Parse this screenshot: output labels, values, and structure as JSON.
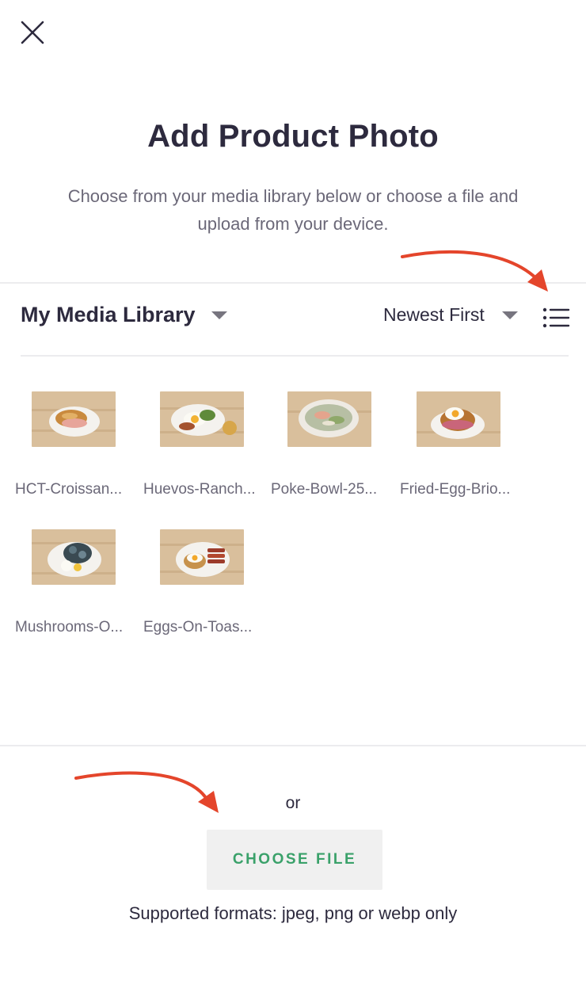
{
  "header": {
    "close_icon": "close-icon",
    "title": "Add Product Photo",
    "subtitle": "Choose from your media library below or choose a file and upload from your device."
  },
  "toolbar": {
    "library_label": "My Media Library",
    "sort_label": "Newest First",
    "list_view_icon": "list-view-icon"
  },
  "media": [
    {
      "name": "HCT-Croissan...",
      "plate": "croissant"
    },
    {
      "name": "Huevos-Ranch...",
      "plate": "huevos"
    },
    {
      "name": "Poke-Bowl-25...",
      "plate": "poke"
    },
    {
      "name": "Fried-Egg-Brio...",
      "plate": "brioche"
    },
    {
      "name": "Mushrooms-O...",
      "plate": "mushrooms"
    },
    {
      "name": "Eggs-On-Toas...",
      "plate": "eggs-toast"
    }
  ],
  "upload": {
    "or_text": "or",
    "choose_label": "CHOOSE FILE",
    "formats_text": "Supported formats: jpeg, png or webp only"
  },
  "colors": {
    "accent_green": "#3aa16a",
    "annotation_arrow": "#e4452b",
    "text_dark": "#2d2a3e"
  }
}
